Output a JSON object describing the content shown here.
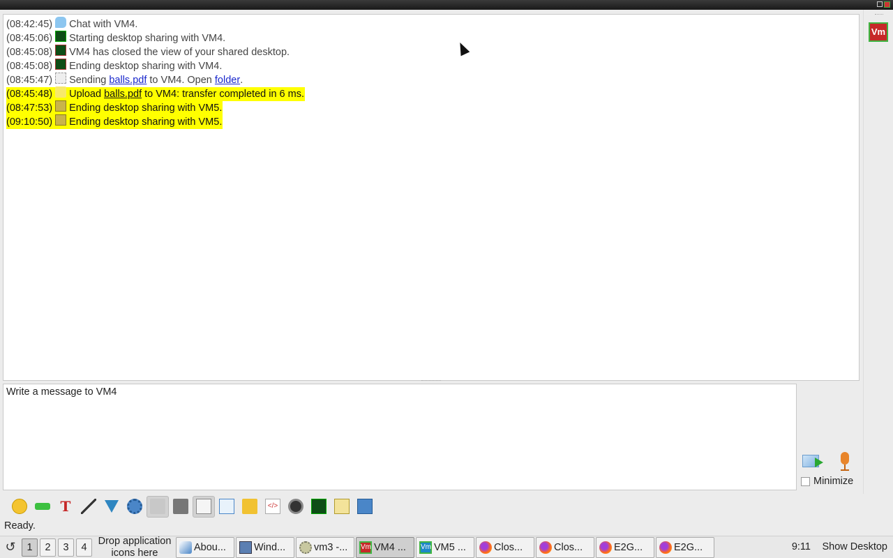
{
  "log": [
    {
      "time": "(08:42:45)",
      "icon": "chat-bubble-icon",
      "highlight": false,
      "parts": [
        {
          "t": "Chat with VM4."
        }
      ]
    },
    {
      "time": "(08:45:06)",
      "icon": "screen-share-icon",
      "highlight": false,
      "parts": [
        {
          "t": "Starting desktop sharing with VM4."
        }
      ]
    },
    {
      "time": "(08:45:08)",
      "icon": "screen-share-closed-icon",
      "highlight": false,
      "parts": [
        {
          "t": "VM4 has closed the view of your shared desktop."
        }
      ]
    },
    {
      "time": "(08:45:08)",
      "icon": "screen-share-closed-icon",
      "highlight": false,
      "parts": [
        {
          "t": "Ending desktop sharing with VM4."
        }
      ]
    },
    {
      "time": "(08:45:47)",
      "icon": "file-send-icon",
      "highlight": false,
      "parts": [
        {
          "t": "Sending "
        },
        {
          "t": "balls.pdf",
          "link": true
        },
        {
          "t": " to VM4. Open "
        },
        {
          "t": "folder",
          "link": true
        },
        {
          "t": "."
        }
      ]
    },
    {
      "time": "(08:45:48)",
      "icon": "upload-icon",
      "highlight": true,
      "parts": [
        {
          "t": "Upload "
        },
        {
          "t": "balls.pdf",
          "link": true
        },
        {
          "t": " to VM4: transfer completed in 6 ms."
        }
      ]
    },
    {
      "time": "(08:47:53)",
      "icon": "screen-share-ended-icon",
      "highlight": true,
      "parts": [
        {
          "t": "Ending desktop sharing with VM5."
        }
      ]
    },
    {
      "time": "(09:10:50)",
      "icon": "screen-share-ended-icon",
      "highlight": true,
      "parts": [
        {
          "t": "Ending desktop sharing with VM5."
        }
      ]
    }
  ],
  "contact": {
    "badge": "Vm"
  },
  "input": {
    "value": "Write a message to VM4"
  },
  "minimize": {
    "label": "Minimize",
    "checked": false
  },
  "toolbar": [
    {
      "name": "emoticon-icon",
      "glyph": "g-smile",
      "pressed": false
    },
    {
      "name": "nudge-icon",
      "glyph": "g-green",
      "pressed": false
    },
    {
      "name": "text-format-icon",
      "glyph": "g-text",
      "text": "T",
      "pressed": false
    },
    {
      "name": "magic-wand-icon",
      "glyph": "g-wand",
      "pressed": false
    },
    {
      "name": "filter-icon",
      "glyph": "g-filter",
      "pressed": false
    },
    {
      "name": "settings-gear-icon",
      "glyph": "g-gear",
      "pressed": false
    },
    {
      "name": "spell-check-icon",
      "glyph": "g-spell",
      "pressed": true
    },
    {
      "name": "font-icon",
      "glyph": "g-font",
      "pressed": false
    },
    {
      "name": "notes-icon",
      "glyph": "g-note",
      "pressed": true
    },
    {
      "name": "export-icon",
      "glyph": "g-export",
      "pressed": false
    },
    {
      "name": "send-file-icon",
      "glyph": "g-yellow",
      "pressed": false
    },
    {
      "name": "code-icon",
      "glyph": "g-code",
      "text": "</>",
      "pressed": false
    },
    {
      "name": "webcam-icon",
      "glyph": "g-cam",
      "pressed": false
    },
    {
      "name": "desktop-share-icon",
      "glyph": "g-screen",
      "pressed": false
    },
    {
      "name": "document-icon",
      "glyph": "g-doc",
      "pressed": false
    },
    {
      "name": "save-icon",
      "glyph": "g-save",
      "pressed": false
    }
  ],
  "status": "Ready.",
  "taskbar": {
    "workspaces": [
      "1",
      "2",
      "3",
      "4"
    ],
    "active_workspace": 0,
    "drop_hint_1": "Drop application",
    "drop_hint_2": "icons here",
    "tasks": [
      {
        "label": "Abou...",
        "icon": "ti-feather",
        "name": "about-window-icon",
        "active": false
      },
      {
        "label": "Wind...",
        "icon": "ti-window",
        "name": "window-icon",
        "active": false
      },
      {
        "label": "vm3 -...",
        "icon": "ti-gear",
        "name": "vm3-app-icon",
        "active": false
      },
      {
        "label": "VM4 ...",
        "icon": "ti-vm4",
        "iconText": "Vm",
        "name": "vm4-chat-icon",
        "active": true
      },
      {
        "label": "VM5 ...",
        "icon": "ti-vm5",
        "iconText": "Vm",
        "name": "vm5-chat-icon",
        "active": false
      },
      {
        "label": "Clos...",
        "icon": "ti-firefox",
        "name": "firefox-icon",
        "active": false
      },
      {
        "label": "Clos...",
        "icon": "ti-firefox",
        "name": "firefox-icon",
        "active": false
      },
      {
        "label": "E2G...",
        "icon": "ti-firefox",
        "name": "firefox-icon",
        "active": false
      },
      {
        "label": "E2G...",
        "icon": "ti-firefox",
        "name": "firefox-icon",
        "active": false
      }
    ],
    "clock": "9:11",
    "show_desktop": "Show Desktop"
  }
}
